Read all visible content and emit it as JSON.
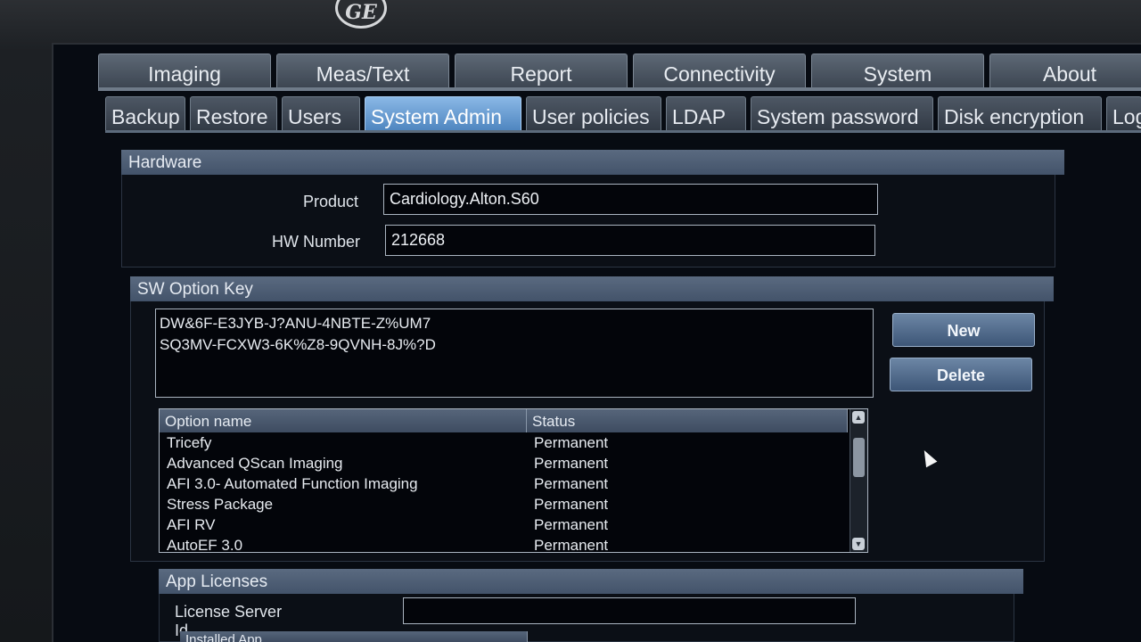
{
  "brand": {
    "logo_text": "GE"
  },
  "main_tabs": [
    {
      "label": "Imaging"
    },
    {
      "label": "Meas/Text"
    },
    {
      "label": "Report"
    },
    {
      "label": "Connectivity"
    },
    {
      "label": "System"
    },
    {
      "label": "About"
    }
  ],
  "sub_tabs": [
    {
      "label": "Backup"
    },
    {
      "label": "Restore"
    },
    {
      "label": "Users"
    },
    {
      "label": "System Admin",
      "active": true
    },
    {
      "label": "User policies"
    },
    {
      "label": "LDAP"
    },
    {
      "label": "System password"
    },
    {
      "label": "Disk encryption"
    },
    {
      "label": "Log"
    }
  ],
  "hardware": {
    "title": "Hardware",
    "product_label": "Product",
    "product_value": "Cardiology.Alton.S60",
    "hw_number_label": "HW Number",
    "hw_number_value": "212668"
  },
  "sw_option_key": {
    "title": "SW Option Key",
    "keys": [
      "DW&6F-E3JYB-J?ANU-4NBTE-Z%UM7",
      "SQ3MV-FCXW3-6K%Z8-9QVNH-8J%?D"
    ],
    "new_label": "New",
    "delete_label": "Delete",
    "table": {
      "columns": [
        "Option name",
        "Status"
      ],
      "rows": [
        [
          "Tricefy",
          "Permanent"
        ],
        [
          "Advanced QScan Imaging",
          "Permanent"
        ],
        [
          "AFI 3.0- Automated Function Imaging",
          "Permanent"
        ],
        [
          "Stress Package",
          "Permanent"
        ],
        [
          "AFI RV",
          "Permanent"
        ],
        [
          "AutoEF 3.0",
          "Permanent"
        ]
      ]
    }
  },
  "app_licenses": {
    "title": "App Licenses",
    "license_server_label": "License Server Id",
    "license_server_value": "",
    "installed_app_label": "Installed App"
  },
  "colors": {
    "active_tab": "#6fa3d8",
    "panel_header": "#4c5d74",
    "background": "#070b12"
  }
}
